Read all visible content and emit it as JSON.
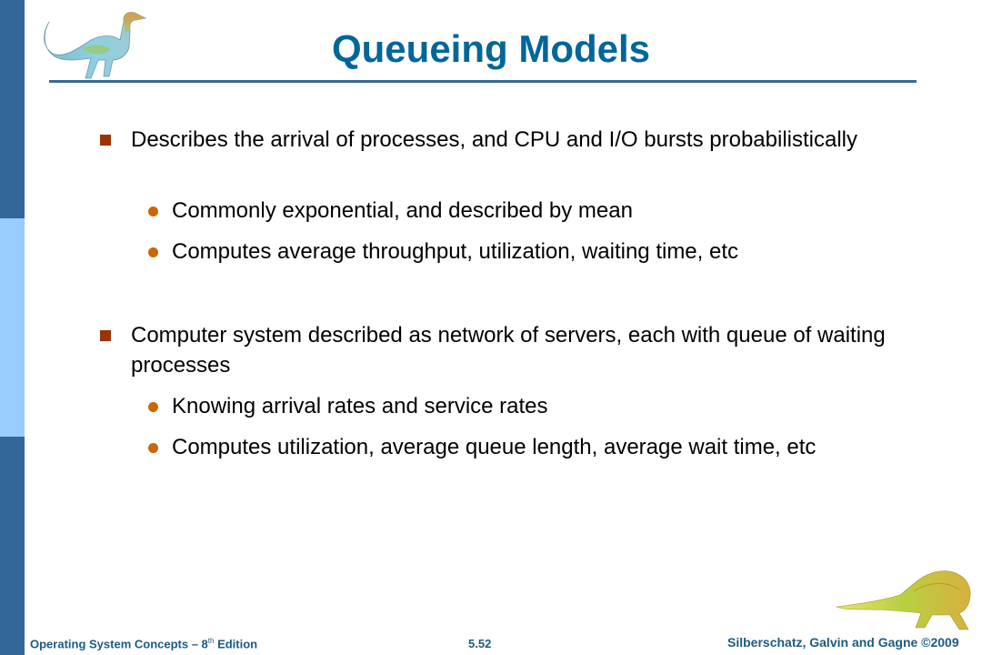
{
  "slide": {
    "title": "Queueing Models",
    "accent_color": "#006699",
    "bullets": [
      {
        "text": "Describes the arrival of processes, and CPU and I/O bursts probabilistically",
        "sub": [
          "Commonly exponential, and described by mean",
          "Computes average throughput, utilization, waiting time, etc"
        ]
      },
      {
        "text": "Computer system described as network of servers, each with queue of waiting processes",
        "sub": [
          "Knowing arrival rates and service rates",
          "Computes utilization, average queue length, average wait time, etc"
        ]
      }
    ]
  },
  "footer": {
    "book_title": "Operating System Concepts – 8",
    "edition_sup": "th",
    "edition_word": " Edition",
    "page_number": "5.52",
    "copyright": "Silberschatz, Galvin and Gagne ©2009"
  },
  "icons": {
    "top_left": "dinosaur-icon",
    "bottom_right": "dinosaur-icon"
  }
}
